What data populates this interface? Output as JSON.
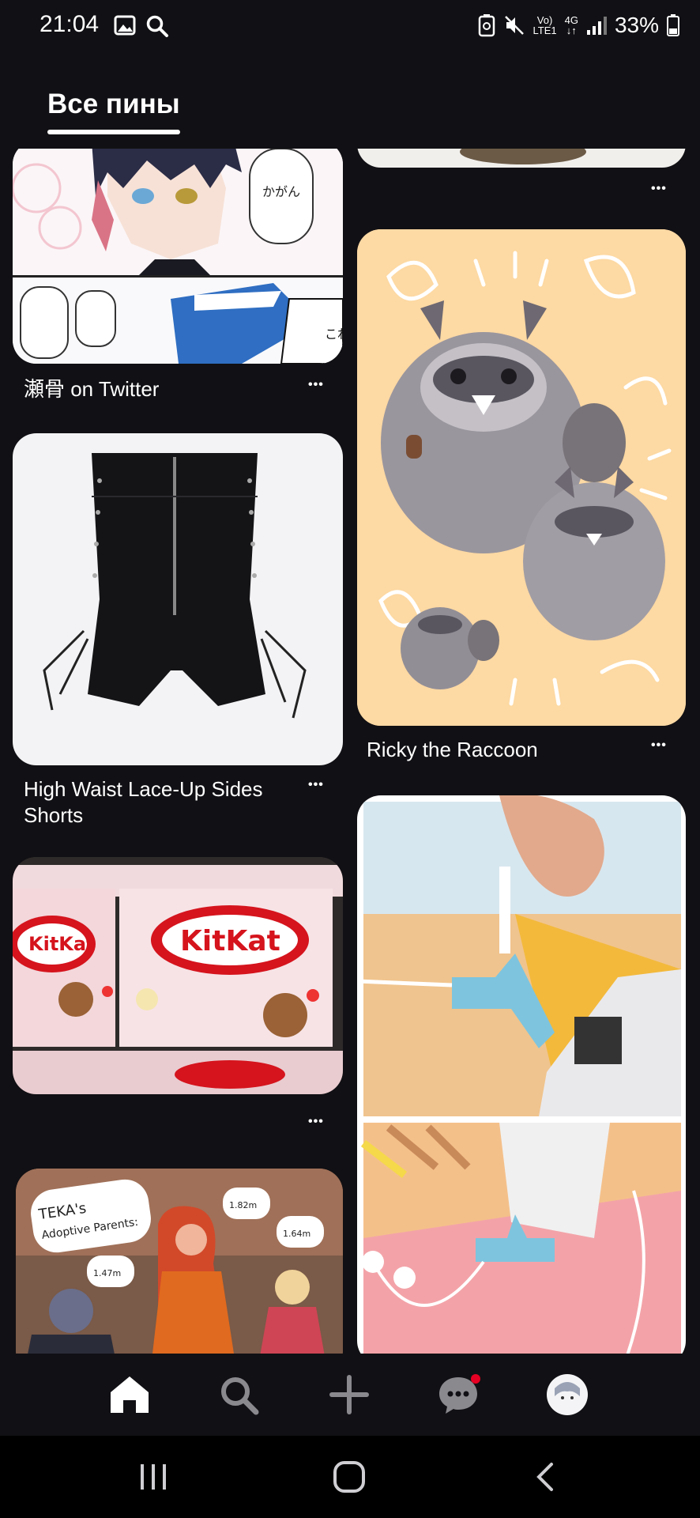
{
  "status_bar": {
    "time": "21:04",
    "battery": "33%",
    "network_top": "Vo)",
    "network_bottom": "LTE1",
    "network_type": "4G"
  },
  "header": {
    "tab_label": "Все пины"
  },
  "pins": [
    {
      "title": "瀬骨 on Twitter"
    },
    {
      "title": "High Waist Lace-Up Sides Shorts"
    },
    {
      "title": "Ricky the Raccoon"
    }
  ],
  "images": {
    "manga_text_1": "かがんでくんね…?",
    "manga_text_2": "これがカワイ",
    "comic_title": "TEKA's Adoptive Parents:",
    "comic_h1": "height: 1.82m",
    "comic_h2": "height: 1.64m",
    "comic_h3": "height: 1.47m",
    "kitkat_brand": "KitKat"
  },
  "more_glyph": "•••",
  "nav": {
    "items": [
      "home-icon",
      "search-icon",
      "plus-icon",
      "messages-icon",
      "avatar"
    ],
    "notification_color": "#e60023"
  },
  "colors": {
    "background": "#111014",
    "accent": "#e60023"
  }
}
